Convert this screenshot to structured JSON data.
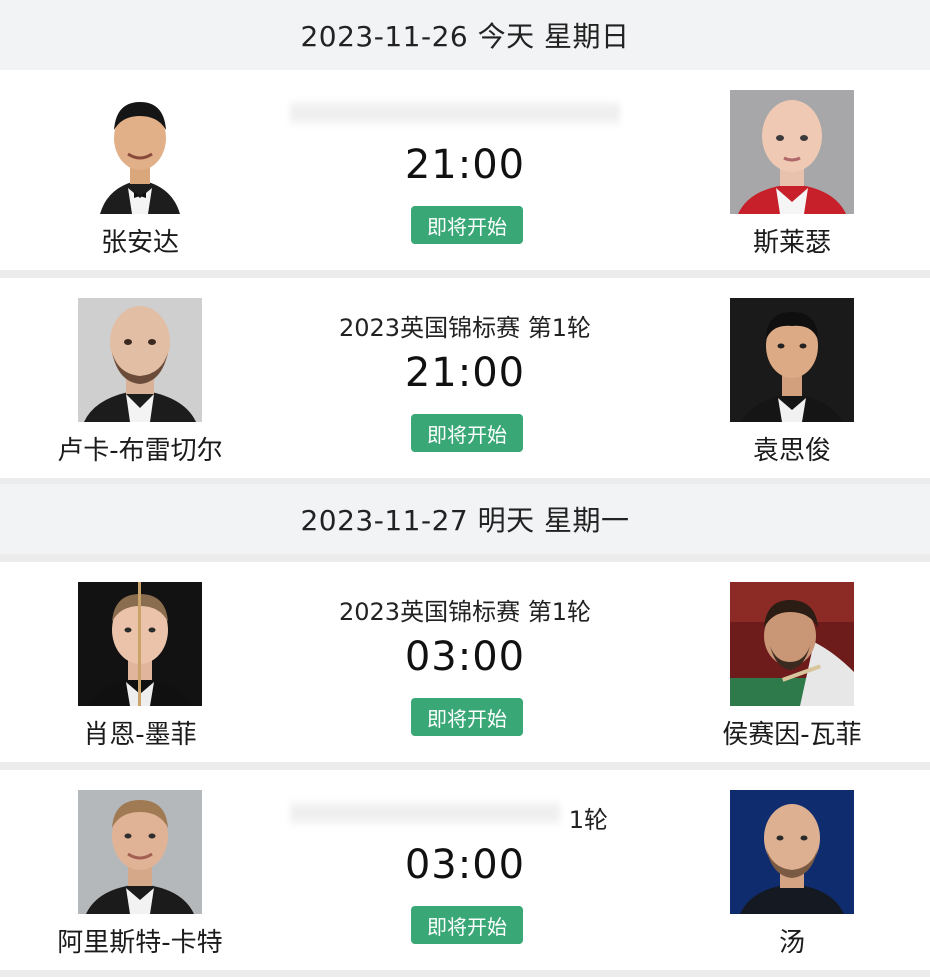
{
  "date_groups": [
    {
      "date_label": "2023-11-26 今天 星期日",
      "matches": [
        {
          "tournament": "",
          "time": "21:00",
          "status": "即将开始",
          "home": {
            "name": "张安达"
          },
          "away": {
            "name": "斯莱瑟"
          }
        },
        {
          "tournament": "2023英国锦标赛 第1轮",
          "time": "21:00",
          "status": "即将开始",
          "home": {
            "name": "卢卡-布雷切尔"
          },
          "away": {
            "name": "袁思俊"
          }
        }
      ]
    },
    {
      "date_label": "2023-11-27 明天 星期一",
      "matches": [
        {
          "tournament": "2023英国锦标赛 第1轮",
          "time": "03:00",
          "status": "即将开始",
          "home": {
            "name": "肖恩-墨菲"
          },
          "away": {
            "name": "侯赛因-瓦菲"
          }
        },
        {
          "tournament": "1轮",
          "time": "03:00",
          "status": "即将开始",
          "home": {
            "name": "阿里斯特-卡特"
          },
          "away": {
            "name": "汤"
          }
        }
      ]
    }
  ],
  "colors": {
    "status_button": "#3aa876",
    "header_bg": "#f2f3f4",
    "card_bg": "#ffffff"
  }
}
